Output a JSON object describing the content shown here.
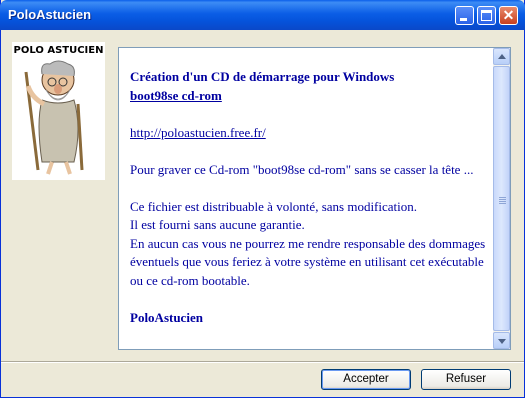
{
  "window": {
    "title": "PoloAstucien"
  },
  "title_buttons": {
    "minimize": "minimize-icon",
    "maximize": "maximize-icon",
    "close": "close-icon",
    "close_glyph": "✕"
  },
  "logo": {
    "text": "POLO ASTUCIEN"
  },
  "content": {
    "heading_line1": "Création d'un CD de démarrage pour Windows",
    "heading_line2": "boot98se cd-rom",
    "link": "http://poloastucien.free.fr/",
    "para1": "Pour graver ce Cd-rom \"boot98se cd-rom\" sans se casser la tête ...",
    "para2_line1": "Ce fichier est distribuable à volonté, sans modification.",
    "para2_line2": "Il est fourni sans aucune garantie.",
    "para2_line3": "En aucun cas vous ne pourrez me rendre responsable des dommages éventuels que vous feriez à votre système en utilisant cet exécutable ou ce cd-rom bootable.",
    "signature": "PoloAstucien"
  },
  "buttons": {
    "accept": "Accepter",
    "refuse": "Refuser"
  },
  "colors": {
    "text_blue": "#0000a0",
    "title_blue": "#0553db",
    "window_bg": "#ece9d8"
  }
}
